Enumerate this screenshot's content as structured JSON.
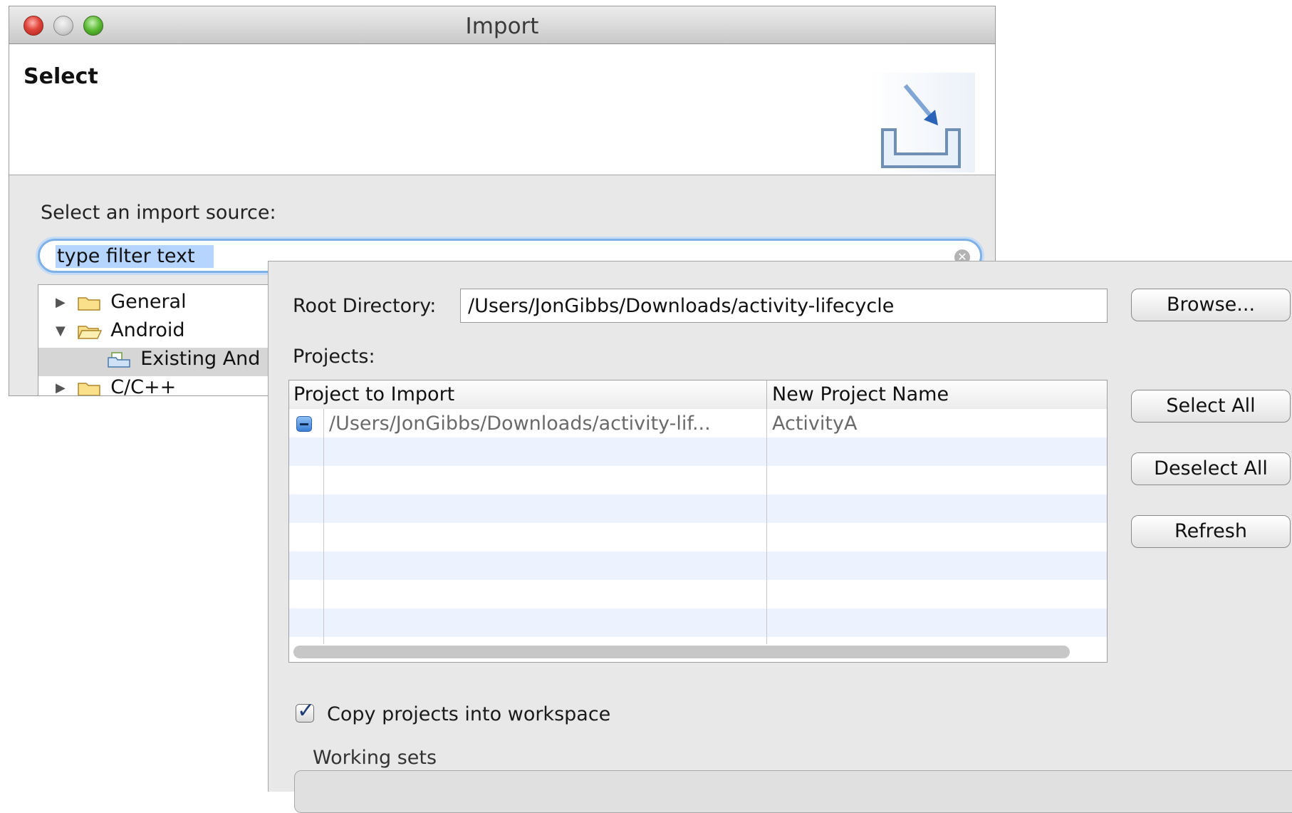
{
  "window": {
    "title": "Import",
    "banner_title": "Select"
  },
  "source": {
    "label": "Select an import source:",
    "filter_value": "type filter text"
  },
  "tree": {
    "items": [
      {
        "label": "General"
      },
      {
        "label": "Android"
      },
      {
        "label": "Existing And"
      },
      {
        "label": "C/C++"
      }
    ]
  },
  "panel": {
    "root_label": "Root Directory:",
    "root_value": "/Users/JonGibbs/Downloads/activity-lifecycle",
    "browse": "Browse...",
    "projects_label": "Projects:",
    "columns": [
      "Project to Import",
      "New Project Name"
    ],
    "rows": [
      {
        "path": "/Users/JonGibbs/Downloads/activity-lif...",
        "name": "ActivityA"
      }
    ],
    "select_all": "Select All",
    "deselect_all": "Deselect All",
    "refresh": "Refresh",
    "copy_label": "Copy projects into workspace",
    "working_sets": "Working sets"
  },
  "colors": {
    "accent": "#7fb0e8",
    "selection": "#b5d5ff",
    "folder": "#e9b949"
  }
}
